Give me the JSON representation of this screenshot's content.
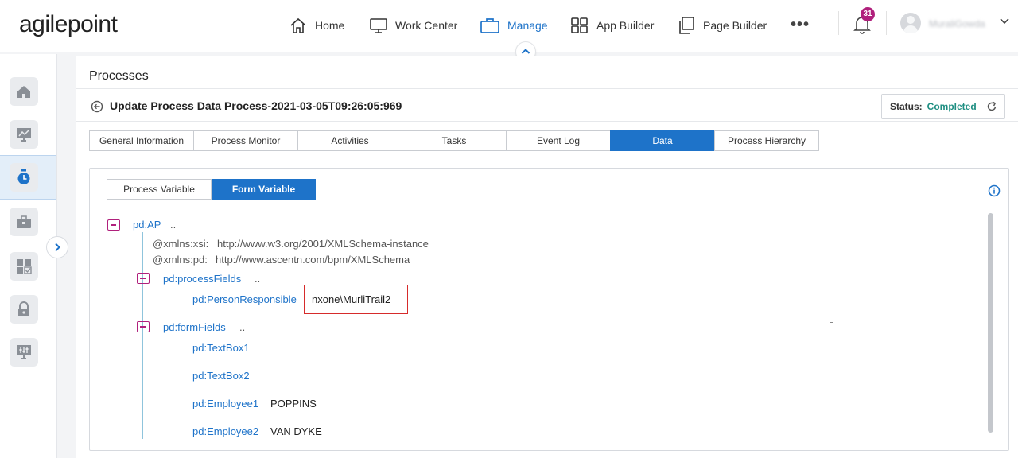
{
  "header": {
    "logo": "agilepoint",
    "nav": [
      {
        "label": "Home",
        "icon": "home-icon"
      },
      {
        "label": "Work Center",
        "icon": "monitor-icon"
      },
      {
        "label": "Manage",
        "icon": "briefcase-icon",
        "active": true
      },
      {
        "label": "App Builder",
        "icon": "grid-icon"
      },
      {
        "label": "Page Builder",
        "icon": "pages-icon"
      }
    ],
    "more": "•••",
    "notifications": "31",
    "username": "MuraliGowda"
  },
  "sidebar": {
    "items": [
      "home-icon",
      "chart-icon",
      "timer-icon",
      "toolbox-icon",
      "apps-icon",
      "lock-icon",
      "settings-icon"
    ],
    "active_index": 2
  },
  "page": {
    "title": "Processes",
    "process_title": "Update Process Data Process-2021-03-05T09:26:05:969",
    "status_label": "Status:",
    "status_value": "Completed"
  },
  "tabs": [
    {
      "label": "General Information"
    },
    {
      "label": "Process Monitor"
    },
    {
      "label": "Activities"
    },
    {
      "label": "Tasks"
    },
    {
      "label": "Event Log"
    },
    {
      "label": "Data",
      "active": true
    },
    {
      "label": "Process Hierarchy"
    }
  ],
  "subtabs": [
    {
      "label": "Process Variable"
    },
    {
      "label": "Form Variable",
      "active": true
    }
  ],
  "tree": {
    "root": "pd:AP",
    "root_dots": "..",
    "attrs": [
      {
        "name": "@xmlns:xsi:",
        "value": "http://www.w3.org/2001/XMLSchema-instance"
      },
      {
        "name": "@xmlns:pd:",
        "value": "http://www.ascentn.com/bpm/XMLSchema"
      }
    ],
    "process_fields": {
      "name": "pd:processFields",
      "dots": "..",
      "children": [
        {
          "name": "pd:PersonResponsible",
          "value": "nxone\\MurliTrail2"
        }
      ]
    },
    "form_fields": {
      "name": "pd:formFields",
      "dots": "..",
      "children": [
        {
          "name": "pd:TextBox1",
          "value": ""
        },
        {
          "name": "pd:TextBox2",
          "value": ""
        },
        {
          "name": "pd:Employee1",
          "value": "POPPINS"
        },
        {
          "name": "pd:Employee2",
          "value": "VAN DYKE"
        }
      ]
    }
  },
  "colors": {
    "accent": "#1e73c9",
    "toggle": "#b0207c",
    "status": "#1f8f82",
    "highlight": "#d62b2b"
  }
}
